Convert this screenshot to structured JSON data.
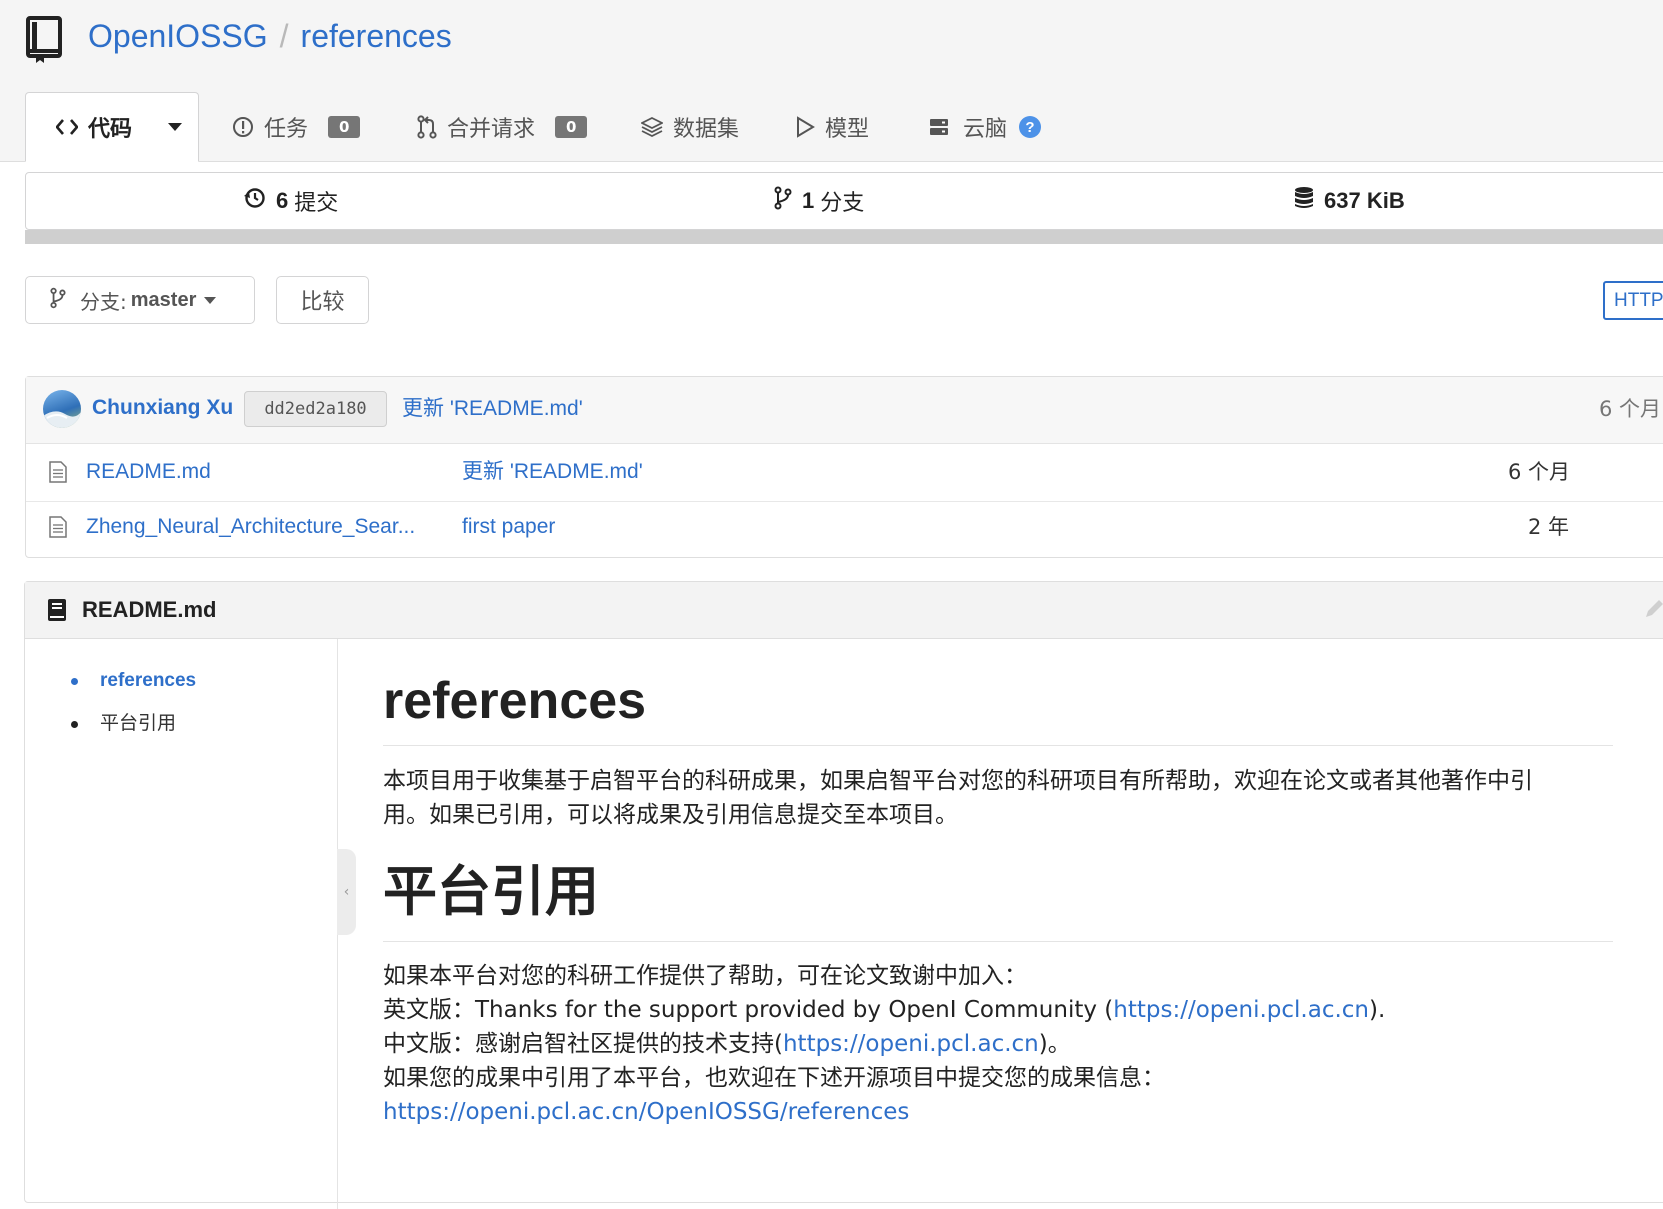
{
  "repo": {
    "owner": "OpenIOSSG",
    "separator": "/",
    "name": "references"
  },
  "tabs": [
    {
      "label": "代码",
      "icon": "code-icon",
      "active": true
    },
    {
      "label": "任务",
      "icon": "issue-icon",
      "count": "0"
    },
    {
      "label": "合并请求",
      "icon": "pull-request-icon",
      "count": "0"
    },
    {
      "label": "数据集",
      "icon": "layers-icon"
    },
    {
      "label": "模型",
      "icon": "play-icon"
    },
    {
      "label": "云脑",
      "icon": "server-icon",
      "help": "?"
    }
  ],
  "stats": {
    "commits_count": "6",
    "commits_label": "提交",
    "branches_count": "1",
    "branches_label": "分支",
    "size": "637 KiB"
  },
  "toolbar": {
    "branch_label": "分支:",
    "branch_value": "master",
    "compare_label": "比较",
    "clone_label": "HTTP"
  },
  "latest_commit": {
    "author": "Chunxiang Xu",
    "sha": "dd2ed2a180",
    "message": "更新 'README.md'",
    "age": "6 个月"
  },
  "files": [
    {
      "name": "README.md",
      "message": "更新 'README.md'",
      "age": "6 个月"
    },
    {
      "name": "Zheng_Neural_Architecture_Sear...",
      "message": "first paper",
      "age": "2 年"
    }
  ],
  "readme": {
    "filename": "README.md",
    "toc": [
      {
        "label": "references"
      },
      {
        "label": "平台引用"
      }
    ],
    "title": "references",
    "intro_line1": "本项目用于收集基于启智平台的科研成果，如果启智平台对您的科研项目有所帮助，欢迎在论文或者其他著作中引",
    "intro_line2": "用。如果已引用，可以将成果及引用信息提交至本项目。",
    "section_title": "平台引用",
    "line1": "如果本平台对您的科研工作提供了帮助，可在论文致谢中加入：",
    "line2_prefix": "英文版：Thanks for the support provided by OpenI Community (",
    "line2_link": "https://openi.pcl.ac.cn",
    "line2_suffix": ").",
    "line3_prefix": "中文版：感谢启智社区提供的技术支持(",
    "line3_link": "https://openi.pcl.ac.cn",
    "line3_suffix": ")。",
    "line4": "如果您的成果中引用了本平台，也欢迎在下述开源项目中提交您的成果信息：",
    "line5_link": "https://openi.pcl.ac.cn/OpenIOSSG/references"
  },
  "colors": {
    "link": "#2e6fc9",
    "badge": "#767676",
    "help": "#4d92e8",
    "accent_border": "#2e6fc9"
  }
}
